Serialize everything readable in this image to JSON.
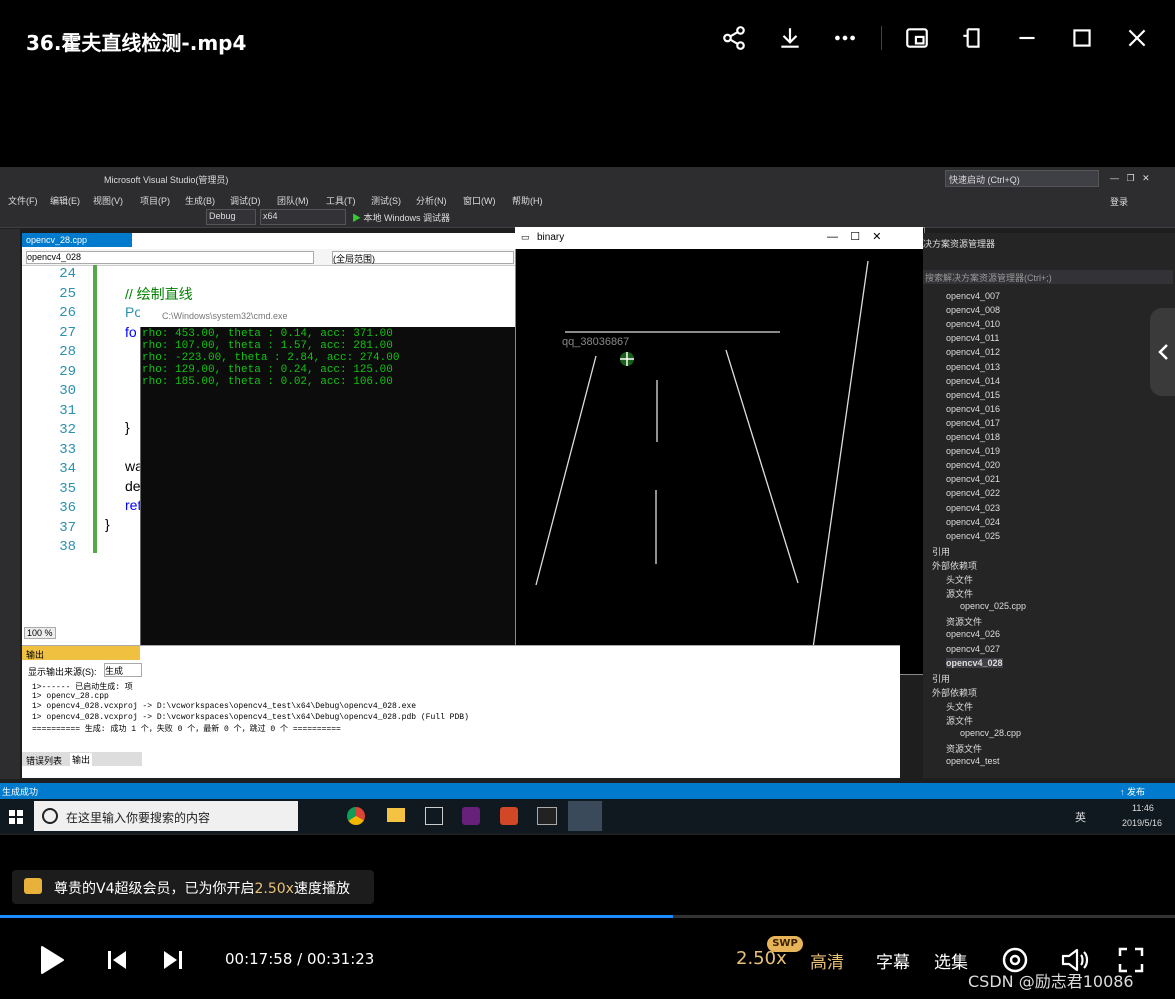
{
  "player": {
    "title": "36.霍夫直线检测-.mp4",
    "icons": [
      "share-icon",
      "download-icon",
      "more-icon",
      "picture-in-picture-icon",
      "mini-window-icon",
      "minimize-icon",
      "maximize-icon",
      "close-icon"
    ],
    "toast": {
      "prefix": "尊贵的V4超级会员，已为你开启",
      "speed": "2.50x",
      "suffix": "速度播放"
    },
    "time_current": "00:17:58",
    "time_sep": " / ",
    "time_total": "00:31:23",
    "progress": 0.573,
    "speed": "2.50x",
    "speed_badge": "SWP",
    "quality": "高清",
    "subtitles": "字幕",
    "episodes": "选集",
    "watermark": "CSDN @励志君10086"
  },
  "vs": {
    "window_title": "Microsoft Visual Studio(管理员)",
    "quick_launch": "快速启动 (Ctrl+Q)",
    "login": "登录",
    "menu": [
      "文件(F)",
      "编辑(E)",
      "视图(V)",
      "项目(P)",
      "生成(B)",
      "调试(D)",
      "团队(M)",
      "工具(T)",
      "测试(S)",
      "分析(N)",
      "窗口(W)",
      "帮助(H)"
    ],
    "config": "Debug",
    "platform": "x64",
    "run_label": "本地 Windows 调试器",
    "editor_tab": "opencv_28.cpp",
    "nav_left": "opencv4_028",
    "nav_right": "(全局范围)",
    "zoom": "100 %",
    "line_numbers": [
      "24",
      "25",
      "26",
      "27",
      "28",
      "29",
      "30",
      "31",
      "32",
      "33",
      "34",
      "35",
      "36",
      "37",
      "38"
    ],
    "code": {
      "comment": "// 绘制直线",
      "po": "Po",
      "fo": "fo",
      "brace1": "}",
      "wa": "wa",
      "de": "de",
      "ret": "ret",
      "brace2": "}"
    },
    "cmd_title": "C:\\Windows\\system32\\cmd.exe",
    "cmd_lines": [
      "rho: 453.00, theta : 0.14, acc: 371.00",
      "rho: 107.00, theta : 1.57, acc: 281.00",
      "rho: -223.00, theta : 2.84, acc: 274.00",
      "rho: 129.00, theta : 0.24, acc: 125.00",
      "rho: 185.00, theta : 0.02, acc: 106.00"
    ],
    "binary_title": "binary",
    "binary_watermark": "qq_38036867",
    "solution_title": "决方案资源管理器",
    "solution_search": "搜索解决方案资源管理器(Ctrl+;)",
    "solution_items": [
      "opencv4_007",
      "opencv4_008",
      "opencv4_010",
      "opencv4_011",
      "opencv4_012",
      "opencv4_013",
      "opencv4_014",
      "opencv4_015",
      "opencv4_016",
      "opencv4_017",
      "opencv4_018",
      "opencv4_019",
      "opencv4_020",
      "opencv4_021",
      "opencv4_022",
      "opencv4_023",
      "opencv4_024",
      "opencv4_025",
      "引用",
      "外部依赖项",
      "头文件",
      "源文件",
      "opencv_025.cpp",
      "资源文件",
      "opencv4_026",
      "opencv4_027",
      "opencv4_028",
      "引用",
      "外部依赖项",
      "头文件",
      "源文件",
      "opencv_28.cpp",
      "资源文件",
      "opencv4_test"
    ],
    "output_title": "输出",
    "output_source_label": "显示输出来源(S):",
    "output_source": "生成",
    "output_lines": [
      "1>------ 已启动生成: 项",
      "1>  opencv_28.cpp",
      "1>  opencv4_028.vcxproj -> D:\\vcworkspaces\\opencv4_test\\x64\\Debug\\opencv4_028.exe",
      "1>  opencv4_028.vcxproj -> D:\\vcworkspaces\\opencv4_test\\x64\\Debug\\opencv4_028.pdb (Full PDB)",
      "========== 生成: 成功 1 个，失败 0 个，最新 0 个，跳过 0 个 =========="
    ],
    "tab_errors": "错误列表",
    "tab_output": "输出",
    "status_left": "生成成功",
    "status_right": "↑ 发布",
    "taskbar_search": "在这里输入你要搜索的内容",
    "clock_time": "11:46",
    "clock_date": "2019/5/16",
    "ime": "英"
  }
}
